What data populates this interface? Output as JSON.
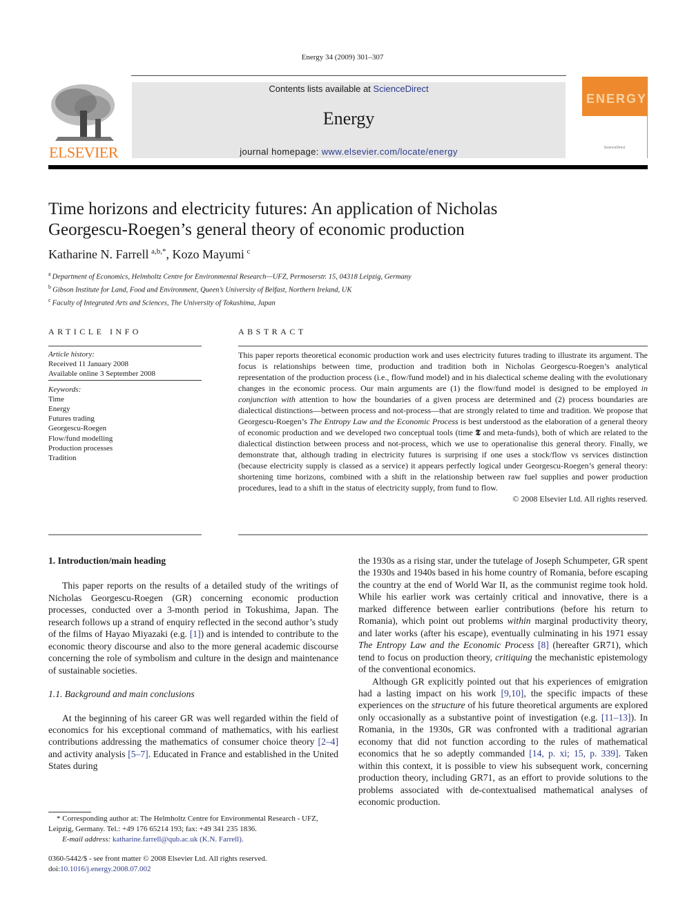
{
  "running_head": "Energy 34 (2009) 301–307",
  "publisher": {
    "logo_text": "ELSEVIER",
    "logo_icon": "elsevier-tree-icon"
  },
  "banner": {
    "contents_prefix": "Contents lists available at ",
    "contents_link": "ScienceDirect",
    "journal_title": "Energy",
    "homepage_prefix": "journal homepage: ",
    "homepage_link": "www.elsevier.com/locate/energy"
  },
  "cover": {
    "word": "ENERGY",
    "foot": "ScienceDirect"
  },
  "colors": {
    "elsevier_orange": "#f07c1f",
    "link_blue": "#2b3a8c",
    "banner_grey": "#e6e6e6",
    "cover_orange": "#ee8a2d"
  },
  "article": {
    "title_line1": "Time horizons and electricity futures: An application of Nicholas",
    "title_line2": "Georgescu-Roegen’s general theory of economic production",
    "authors": [
      {
        "name": "Katharine N. Farrell",
        "sup": "a,b,*"
      },
      {
        "name": "Kozo Mayumi",
        "sup": "c"
      }
    ],
    "author_sep": ", ",
    "affiliations": [
      {
        "sup": "a",
        "text": "Department of Economics, Helmholtz Centre for Environmental Research—UFZ, Permoserstr. 15, 04318 Leipzig, Germany"
      },
      {
        "sup": "b",
        "text": "Gibson Institute for Land, Food and Environment, Queen’s University of Belfast, Northern Ireland, UK"
      },
      {
        "sup": "c",
        "text": "Faculty of Integrated Arts and Sciences, The University of Tokushima, Japan"
      }
    ]
  },
  "article_info": {
    "heading": "ARTICLE INFO",
    "history_label": "Article history:",
    "received": "Received 11 January 2008",
    "available": "Available online 3 September 2008",
    "keywords_label": "Keywords:",
    "keywords": [
      "Time",
      "Energy",
      "Futures trading",
      "Georgescu-Roegen",
      "Flow/fund modelling",
      "Production processes",
      "Tradition"
    ]
  },
  "abstract": {
    "heading": "ABSTRACT",
    "p1": "This paper reports theoretical economic production work and uses electricity futures trading to illustrate its argument. The focus is relationships between time, production and tradition both in Nicholas Georgescu-Roegen’s analytical representation of the production process (i.e., flow/fund model) and in his dialectical scheme dealing with the evolutionary changes in the economic process. Our main arguments are (1) the flow/fund model is designed to be employed ",
    "p1_em": "in conjunction with",
    "p2": " attention to how the boundaries of a given process are determined and (2) process boundaries are dialectical distinctions—between process and not-process—that are strongly related to time and tradition. We propose that Georgescu-Roegen’s ",
    "p2_em": "The Entropy Law and the Economic Process",
    "p3": " is best understood as the elaboration of a general theory of economic production and we developed two conceptual tools (time ",
    "p3_symbol": "𝕿",
    "p4": " and meta-funds), both of which are related to the dialectical distinction between process and not-process, which we use to operationalise this general theory. Finally, we demonstrate that, although trading in electricity futures is surprising if one uses a stock/flow vs services distinction (because electricity supply is classed as a service) it appears perfectly logical under Georgescu-Roegen’s general theory: shortening time horizons, combined with a shift in the relationship between raw fuel supplies and power production procedures, lead to a shift in the status of electricity supply, from fund to flow.",
    "copyright": "© 2008 Elsevier Ltd. All rights reserved."
  },
  "body": {
    "section1_heading": "1.  Introduction/main heading",
    "s1p1_a": "This paper reports on the results of a detailed study of the writings of Nicholas Georgescu-Roegen (GR) concerning economic production processes, conducted over a 3-month period in Tokushima, Japan. The research follows up a strand of enquiry reflected in the second author’s study of the films of Hayao Miyazaki (e.g. ",
    "s1p1_ref": "[1]",
    "s1p1_b": ") and is intended to contribute to the economic theory discourse and also to the more general academic discourse concerning the role of symbolism and culture in the design and maintenance of sustainable societies.",
    "section11_heading": "1.1.  Background and main conclusions",
    "s11p1_a": "At the beginning of his career GR was well regarded within the field of economics for his exceptional command of mathematics, with his earliest contributions addressing the mathematics of consumer choice theory ",
    "s11p1_ref1": "[2–4]",
    "s11p1_b": " and activity analysis ",
    "s11p1_ref2": "[5–7]",
    "s11p1_c": ". Educated in France and established in the United States during",
    "r_p1_a": "the 1930s as a rising star, under the tutelage of Joseph Schumpeter, GR spent the 1930s and 1940s based in his home country of Romania, before escaping the country at the end of World War II, as the communist regime took hold. While his earlier work was certainly critical and innovative, there is a marked difference between earlier contributions (before his return to Romania), which point out problems ",
    "r_p1_em1": "within",
    "r_p1_b": " marginal productivity theory, and later works (after his escape), eventually culminating in his 1971 essay ",
    "r_p1_em2": "The Entropy Law and the Economic Process",
    "r_p1_c": " ",
    "r_p1_ref": "[8]",
    "r_p1_d": " (hereafter GR71), which tend to focus on production theory, ",
    "r_p1_em3": "critiquing",
    "r_p1_e": " the mechanistic epistemology of the conventional economics.",
    "r_p2_a": "Although GR explicitly pointed out that his experiences of emigration had a lasting impact on his work ",
    "r_p2_ref1": "[9,10]",
    "r_p2_b": ", the specific impacts of these experiences on the ",
    "r_p2_em": "structure",
    "r_p2_c": " of his future theoretical arguments are explored only occasionally as a substantive point of investigation (e.g. ",
    "r_p2_ref2": "[11–13]",
    "r_p2_d": "). In Romania, in the 1930s, GR was confronted with a traditional agrarian economy that did not function according to the rules of mathematical economics that he so adeptly commanded ",
    "r_p2_ref3": "[14, p. xi; 15, p. 339]",
    "r_p2_e": ". Taken within this context, it is possible to view his subsequent work, concerning production theory, including GR71, as an effort to provide solutions to the problems associated with de-contextualised mathematical analyses of economic production."
  },
  "footnotes": {
    "corresponding": "* Corresponding author at: The Helmholtz Centre for Environmental Research - UFZ, Leipzig, Germany. Tel.: +49 176 65214 193; fax: +49 341 235 1836.",
    "email_label": "E-mail address: ",
    "email": "katharine.farrell@qub.ac.uk (K.N. Farrell).",
    "front_matter": "0360-5442/$ - see front matter © 2008 Elsevier Ltd. All rights reserved.",
    "doi_label": "doi:",
    "doi": "10.1016/j.energy.2008.07.002"
  }
}
